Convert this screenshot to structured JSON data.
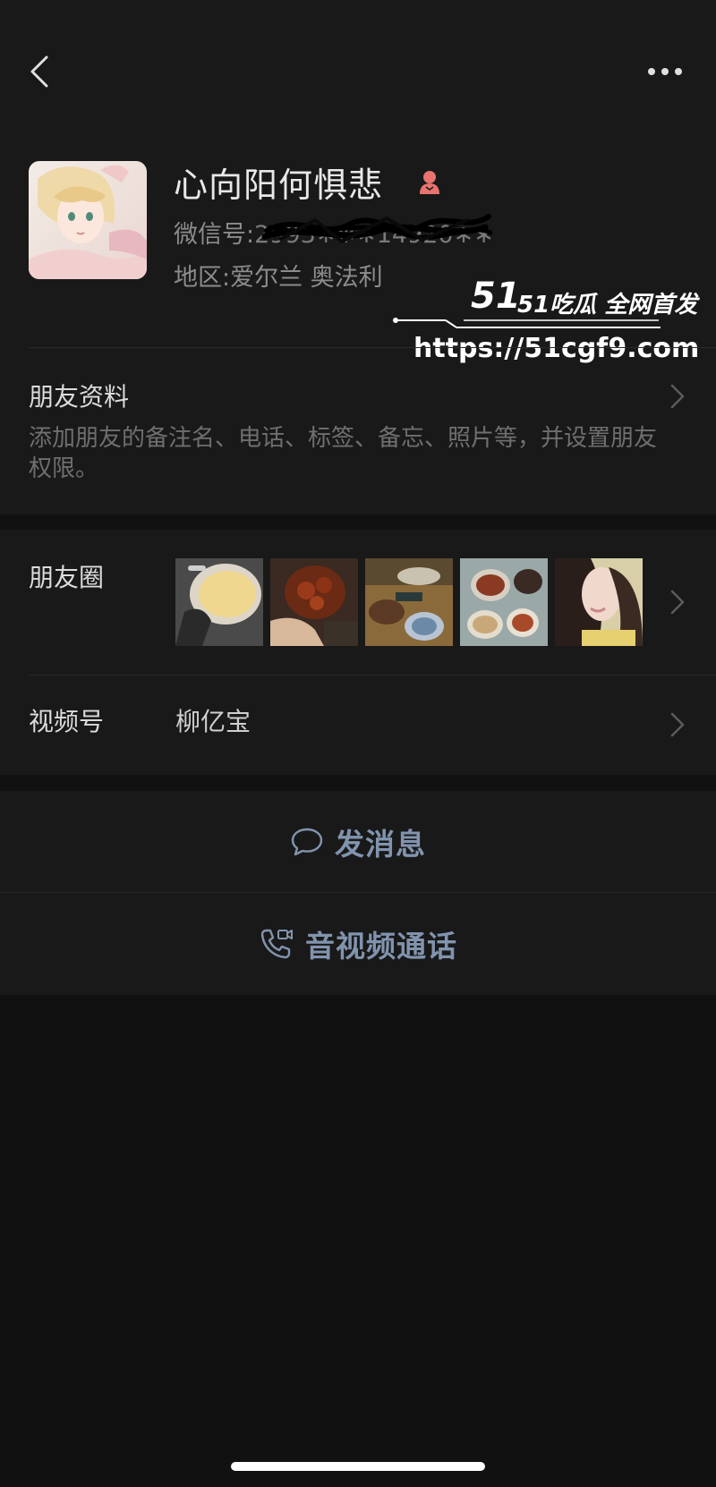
{
  "header": {
    "back_icon": "chevron-left-icon",
    "more_icon": "more-dots-icon"
  },
  "profile": {
    "name": "心向阳何惧悲",
    "gender_icon": "female-icon",
    "gender_color": "#e8736f",
    "wxid_label": "微信号:",
    "wxid_value": "2993∗∗∗14920∗∗",
    "region": "地区:爱尔兰 奥法利"
  },
  "watermark": {
    "brand": "51吃瓜 全网首发",
    "url": "https://51cgf9.com"
  },
  "friend_info": {
    "title": "朋友资料",
    "description": "添加朋友的备注名、电话、标签、备忘、照片等，并设置朋友权限。"
  },
  "moments": {
    "title": "朋友圈",
    "thumbnails": [
      "pudding-photo",
      "braised-meat-photo",
      "restaurant-table-photo",
      "dishes-spread-photo",
      "selfie-photo"
    ]
  },
  "channels": {
    "title": "视频号",
    "value": "柳亿宝"
  },
  "actions": {
    "message": "发消息",
    "message_icon": "chat-bubble-icon",
    "call": "音视频通话",
    "call_icon": "phone-video-icon"
  },
  "colors": {
    "background": "#111111",
    "card": "#191919",
    "action_text": "#8194ae",
    "secondary_text": "#8c8c8c"
  }
}
